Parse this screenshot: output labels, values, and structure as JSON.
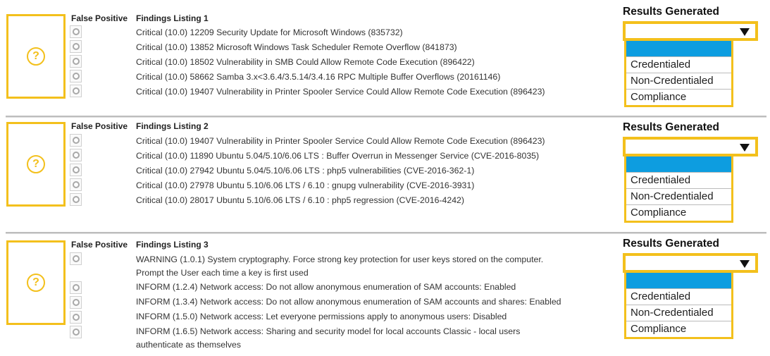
{
  "colors": {
    "accent_yellow": "#f3c01c",
    "selected_blue": "#0d9de0",
    "separator": "#bdbdbd"
  },
  "sections": [
    {
      "false_positive_label": "False Positive",
      "findings_title": "Findings Listing 1",
      "placeholder_icon": "question-icon",
      "placeholder_glyph": "?",
      "findings": [
        "Critical (10.0) 12209 Security Update for Microsoft Windows (835732)",
        "Critical (10.0) 13852 Microsoft Windows Task Scheduler Remote Overflow (841873)",
        "Critical (10.0) 18502 Vulnerability in SMB Could Allow Remote Code Execution (896422)",
        "Critical (10.0) 58662 Samba 3.x<3.6.4/3.5.14/3.4.16 RPC Multiple Buffer Overflows (20161146)",
        "Critical (10.0) 19407 Vulnerability in Printer Spooler Service Could Allow Remote Code Execution (896423)"
      ],
      "results_title": "Results Generated",
      "dropdown_value": "",
      "dropdown_options": [
        "",
        "Credentialed",
        "Non-Credentialed",
        "Compliance"
      ]
    },
    {
      "false_positive_label": "False Positive",
      "findings_title": "Findings Listing 2",
      "placeholder_icon": "question-icon",
      "placeholder_glyph": "?",
      "findings": [
        "Critical (10.0) 19407 Vulnerability in Printer Spooler Service Could Allow Remote Code Execution (896423)",
        "Critical (10.0) 11890 Ubuntu 5.04/5.10/6.06 LTS : Buffer Overrun in Messenger Service (CVE-2016-8035)",
        "Critical (10.0) 27942 Ubuntu 5.04/5.10/6.06 LTS : php5 vulnerabilities (CVE-2016-362-1)",
        "Critical (10.0) 27978 Ubuntu 5.10/6.06 LTS / 6.10 : gnupg vulnerability (CVE-2016-3931)",
        "Critical (10.0) 28017 Ubuntu 5.10/6.06 LTS / 6.10 : php5 regression (CVE-2016-4242)"
      ],
      "results_title": "Results Generated",
      "dropdown_value": "",
      "dropdown_options": [
        "",
        "Credentialed",
        "Non-Credentialed",
        "Compliance"
      ]
    },
    {
      "false_positive_label": "False Positive",
      "findings_title": "Findings Listing 3",
      "placeholder_icon": "question-icon",
      "placeholder_glyph": "?",
      "findings": [
        "WARNING (1.0.1) System cryptography. Force strong key protection for user keys stored on the computer.",
        "Prompt the User each time a key is first used",
        "INFORM (1.2.4) Network access: Do not allow anonymous enumeration of SAM accounts: Enabled",
        "INFORM (1.3.4) Network access: Do not allow anonymous enumeration of SAM accounts and shares:  Enabled",
        "INFORM (1.5.0) Network access: Let everyone permissions apply to anonymous users: Disabled",
        "INFORM (1.6.5) Network access: Sharing and security model for local accounts Classic - local users",
        "authenticate as themselves"
      ],
      "results_title": "Results Generated",
      "dropdown_value": "",
      "dropdown_options": [
        "",
        "Credentialed",
        "Non-Credentialed",
        "Compliance"
      ]
    }
  ]
}
